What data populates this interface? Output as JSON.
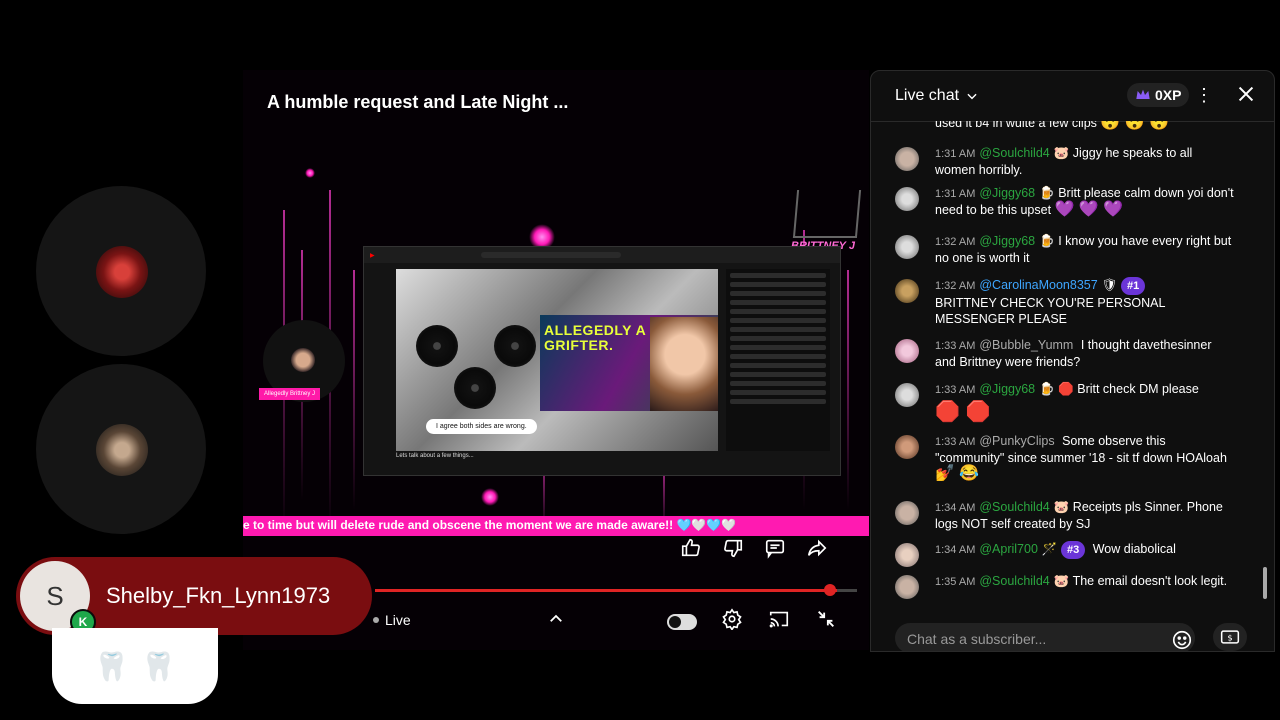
{
  "video": {
    "title": "A humble request and Late Night ...",
    "ticker": "e to time but will delete rude and obscene the moment we are made aware!! 🩵🤍🩵🤍",
    "live_label": "Live",
    "overlay_logo": "BRITTNEY J",
    "cam_label": "Allegedly Brittney J",
    "inner": {
      "banner_text": "ALLEGEDLY A GRIFTER.",
      "caption": "I agree both sides are wrong.",
      "bottom_title": "Lets talk about a few things..."
    }
  },
  "user_overlay": {
    "initial": "S",
    "badge": "K",
    "name": "Shelby_Fkn_Lynn1973",
    "emojis": [
      "🦷",
      "🦷"
    ]
  },
  "chat": {
    "title": "Live chat",
    "xp": "0XP",
    "input_placeholder": "Chat as a subscriber...",
    "top_fragment": "used it b4 in wuite a few clips",
    "top_fragment_emojis": "😯 😯 😯",
    "messages": [
      {
        "time": "1:31 AM",
        "author": "@Soulchild4",
        "badge": "🐷",
        "text": "Jiggy he speaks to all women horribly."
      },
      {
        "time": "1:31 AM",
        "author": "@Jiggy68",
        "badge": "🍺",
        "text": "Britt please calm down yoi don't need to be this upset",
        "emojis": "💜 💜 💜"
      },
      {
        "time": "1:32 AM",
        "author": "@Jiggy68",
        "badge": "🍺",
        "text": "I know you have every right but no one is worth it"
      },
      {
        "time": "1:32 AM",
        "author": "@CarolinaMoon8357",
        "badge": "🛡",
        "rank": "#1",
        "text": "BRITTNEY CHECK YOU'RE PERSONAL MESSENGER PLEASE"
      },
      {
        "time": "1:33 AM",
        "author": "@Bubble_Yumm",
        "text": "I thought davethesinner and Brittney were friends?"
      },
      {
        "time": "1:33 AM",
        "author": "@Jiggy68",
        "badge": "🍺",
        "text": "🛑 Britt check DM please",
        "emojis": "🛑 🛑"
      },
      {
        "time": "1:33 AM",
        "author": "@PunkyClips",
        "text": "Some observe this \"community\" since summer '18 - sit tf down HOAloah",
        "emojis": "💅 😂"
      },
      {
        "time": "1:34 AM",
        "author": "@Soulchild4",
        "badge": "🐷",
        "text": "Receipts pls Sinner. Phone logs NOT self created by SJ"
      },
      {
        "time": "1:34 AM",
        "author": "@April700",
        "badge": "🪄",
        "rank": "#3",
        "text": "Wow diabolical"
      },
      {
        "time": "1:35 AM",
        "author": "@Soulchild4",
        "badge": "🐷",
        "text": "The email doesn't look legit."
      }
    ]
  }
}
